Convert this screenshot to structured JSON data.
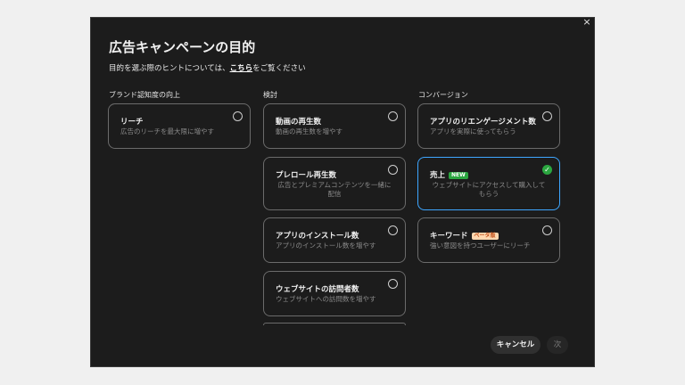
{
  "dialog": {
    "close_glyph": "×",
    "title": "広告キャンペーンの目的",
    "subtitle_prefix": "目的を選ぶ際のヒントについては、",
    "subtitle_link": "こちら",
    "subtitle_suffix": "をご覧ください"
  },
  "columns": [
    {
      "heading": "ブランド認知度の向上",
      "cards": [
        {
          "title": "リーチ",
          "desc": "広告のリーチを最大限に増やす",
          "selected": false
        }
      ]
    },
    {
      "heading": "検討",
      "cards": [
        {
          "title": "動画の再生数",
          "desc": "動画の再生数を増やす",
          "selected": false
        },
        {
          "title": "プレロール再生数",
          "desc": "広告とプレミアムコンテンツを一緒に配信",
          "selected": false
        },
        {
          "title": "アプリのインストール数",
          "desc": "アプリのインストール数を増やす",
          "selected": false
        },
        {
          "title": "ウェブサイトの訪問者数",
          "desc": "ウェブサイトへの訪問数を増やす",
          "selected": false
        }
      ]
    },
    {
      "heading": "コンバージョン",
      "cards": [
        {
          "title": "アプリのリエンゲージメント数",
          "desc": "アプリを実際に使ってもらう",
          "selected": false
        },
        {
          "title": "売上",
          "badge": "NEW",
          "desc": "ウェブサイトにアクセスして購入してもらう",
          "selected": true
        },
        {
          "title": "キーワード",
          "badge": "ベータ版",
          "desc": "強い意図を持つユーザーにリーチ",
          "selected": false
        }
      ]
    }
  ],
  "icons": {
    "checked_radio": "check-icon",
    "close": "close-icon"
  },
  "colors": {
    "selected_border": "#3ea6ff",
    "check_green": "#2ba640",
    "background": "#1c1c1c"
  },
  "footer": {
    "cancel_label": "キャンセル",
    "next_label": "次"
  }
}
